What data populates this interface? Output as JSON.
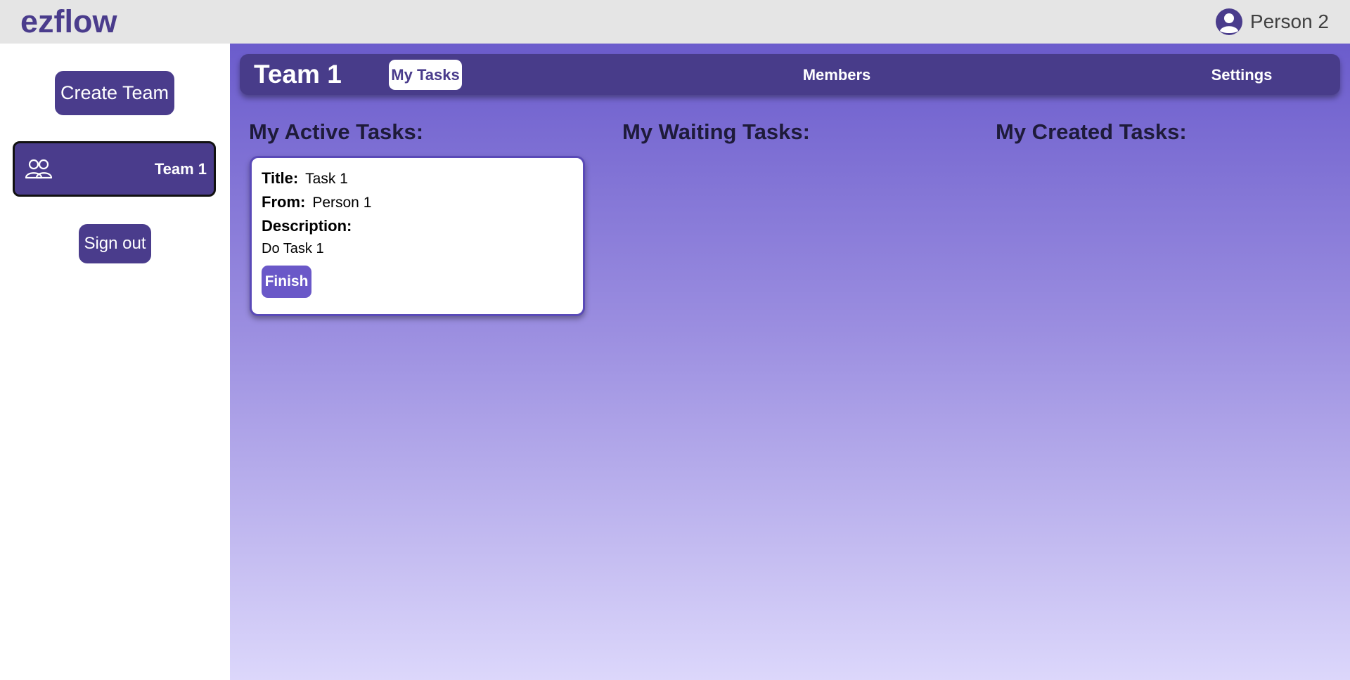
{
  "colors": {
    "brand": "#4a3c8c",
    "accent": "#6a58c8",
    "topbar_bg": "#e5e5e5",
    "gradient_top": "#6b5ccc",
    "gradient_bottom": "#dcd7fb",
    "nav_bg": "#483c8a"
  },
  "header": {
    "brand": "ezflow",
    "user_icon": "user-avatar-icon",
    "user_name": "Person 2"
  },
  "sidebar": {
    "create_team_label": "Create Team",
    "teams": [
      {
        "icon": "group-icon",
        "label": "Team 1"
      }
    ],
    "sign_out_label": "Sign out"
  },
  "team_nav": {
    "title": "Team 1",
    "tabs": [
      {
        "label": "My Tasks",
        "active": true
      },
      {
        "label": "Members",
        "active": false
      },
      {
        "label": "Settings",
        "active": false
      }
    ]
  },
  "columns": [
    {
      "heading": "My Active Tasks:"
    },
    {
      "heading": "My Waiting Tasks:"
    },
    {
      "heading": "My Created Tasks:"
    }
  ],
  "tasks": [
    {
      "title_label": "Title:",
      "title": "Task 1",
      "from_label": "From:",
      "from": "Person 1",
      "description_label": "Description:",
      "description": "Do Task 1",
      "action_label": "Finish"
    }
  ]
}
